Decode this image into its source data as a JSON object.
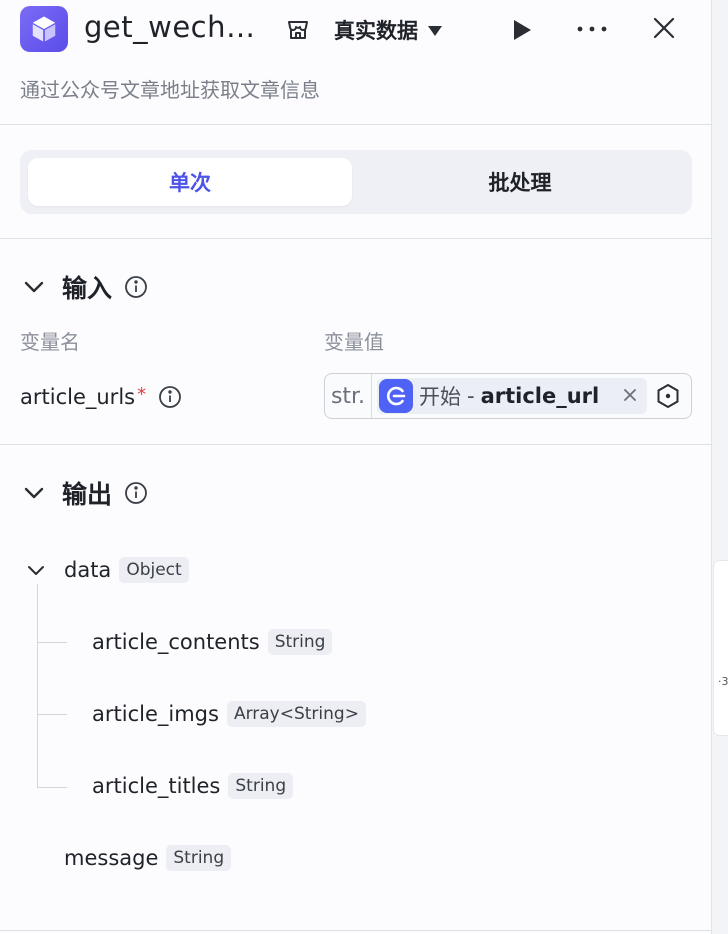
{
  "header": {
    "title": "get_wech…",
    "data_mode": "真实数据",
    "description": "通过公众号文章地址获取文章信息"
  },
  "tabs": [
    {
      "label": "单次",
      "active": true
    },
    {
      "label": "批处理",
      "active": false
    }
  ],
  "input_section": {
    "title": "输入",
    "col_name_label": "变量名",
    "col_value_label": "变量值",
    "variable": {
      "name": "article_urls",
      "required_mark": "*",
      "type_prefix": "str.",
      "ref_node": "开始",
      "ref_separator": "-",
      "ref_var": "article_url",
      "remove_glyph": "×"
    }
  },
  "output_section": {
    "title": "输出",
    "fields": [
      {
        "name": "data",
        "type": "Object"
      },
      {
        "name": "article_contents",
        "type": "String"
      },
      {
        "name": "article_imgs",
        "type": "Array<String>"
      },
      {
        "name": "article_titles",
        "type": "String"
      },
      {
        "name": "message",
        "type": "String"
      }
    ]
  },
  "canvas_peek": {
    "text": "·3"
  },
  "colors": {
    "accent": "#4d53e8",
    "app_icon": "#6a5cf0",
    "node_icon": "#4e63f5",
    "required": "#e5383b"
  },
  "icons": [
    "cube-icon",
    "store-icon",
    "caret-down-icon",
    "play-icon",
    "more-icon",
    "close-icon",
    "chevron-down-icon",
    "info-icon",
    "start-node-icon",
    "variable-settings-icon"
  ]
}
